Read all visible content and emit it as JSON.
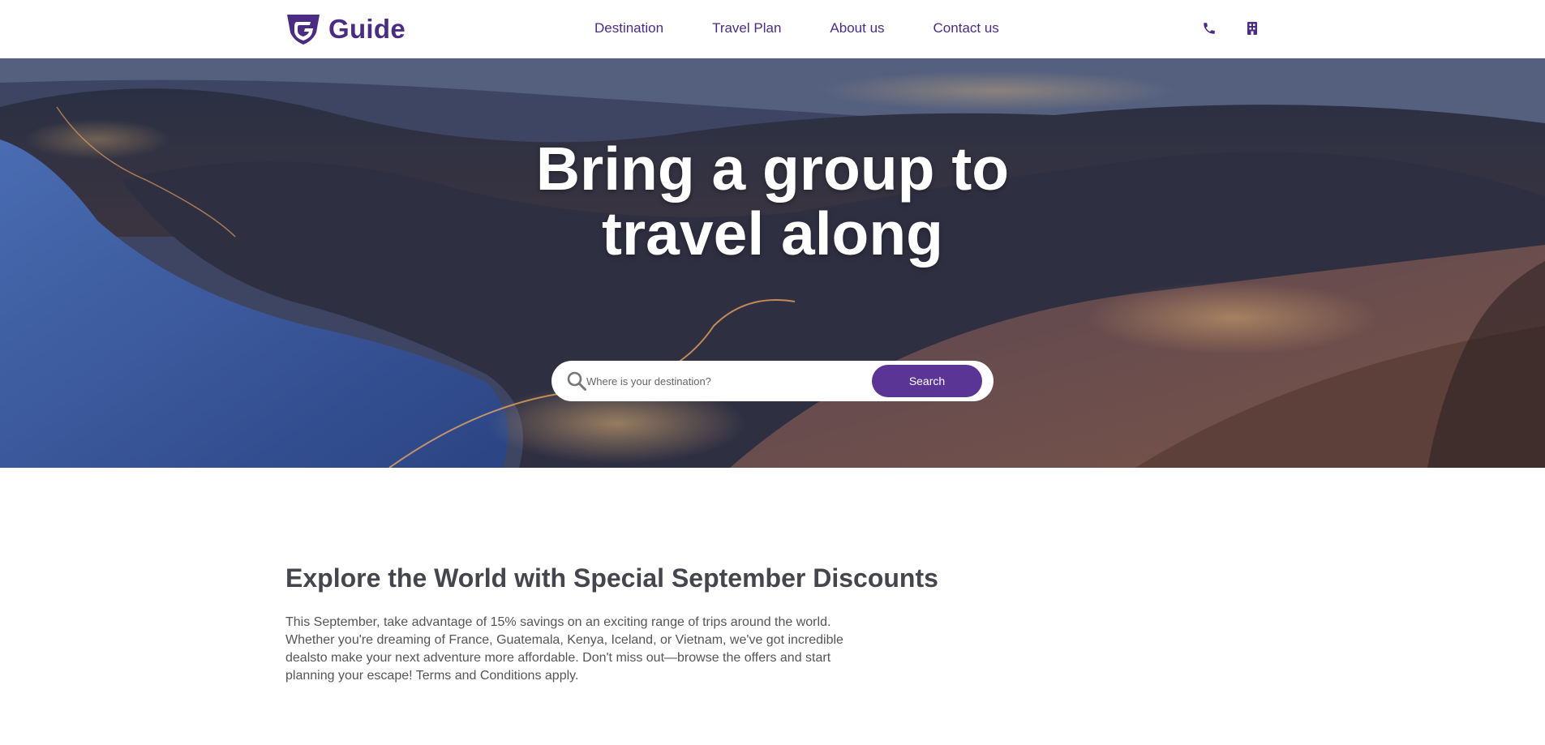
{
  "brand": {
    "name": "Guide",
    "color": "#4a2d82"
  },
  "nav": {
    "items": [
      {
        "label": "Destination"
      },
      {
        "label": "Travel Plan"
      },
      {
        "label": "About us"
      },
      {
        "label": "Contact us"
      }
    ]
  },
  "header_icons": [
    "phone-icon",
    "building-icon"
  ],
  "hero": {
    "title_line1": "Bring a group to",
    "title_line2": "travel along",
    "search": {
      "placeholder": "Where is your destination?",
      "value": "",
      "button_label": "Search",
      "button_color": "#5a3595"
    }
  },
  "promo": {
    "title": "Explore the World with Special September Discounts",
    "body": "This September, take advantage of 15% savings on an exciting range of trips around the world. Whether you're dreaming of France, Guatemala, Kenya, Iceland, or Vietnam, we've got incredible dealsto make your next adventure more affordable. Don't miss out—browse the offers and start planning your escape! Terms and Conditions apply."
  }
}
